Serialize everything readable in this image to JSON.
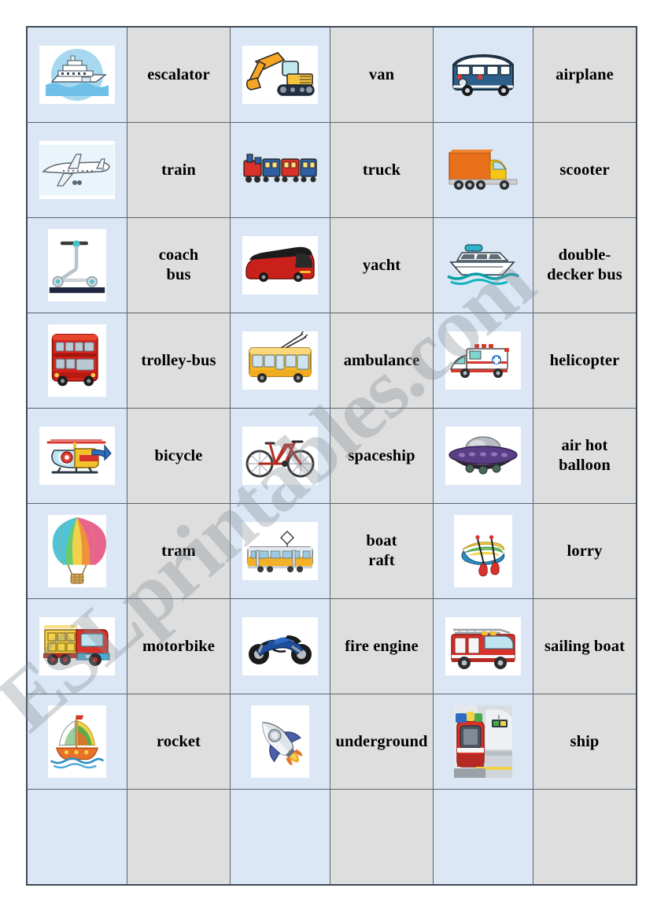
{
  "document": {
    "type": "domino-worksheet",
    "topic": "Transport",
    "columns": 6,
    "rows": 9,
    "colors": {
      "picture_cell_bg": "#dbe7f4",
      "word_cell_bg": "#dedede",
      "grid_line": "#5a646e",
      "table_border": "#3f4a55",
      "page_bg": "#ffffff",
      "watermark": "#828c96"
    }
  },
  "watermark": {
    "text": "ESLprintables.com"
  },
  "grid": {
    "rows": [
      {
        "cells": [
          {
            "kind": "picture",
            "icon": "cruise-ship-icon",
            "label": "cruise ship"
          },
          {
            "kind": "word",
            "lines": [
              "escalator"
            ]
          },
          {
            "kind": "picture",
            "icon": "excavator-icon",
            "label": "excavator"
          },
          {
            "kind": "word",
            "lines": [
              "van"
            ]
          },
          {
            "kind": "picture",
            "icon": "van-icon",
            "label": "blue van"
          },
          {
            "kind": "word",
            "lines": [
              "airplane"
            ]
          }
        ]
      },
      {
        "cells": [
          {
            "kind": "picture",
            "icon": "airplane-icon",
            "label": "airplane"
          },
          {
            "kind": "word",
            "lines": [
              "train"
            ]
          },
          {
            "kind": "picture",
            "icon": "train-icon",
            "label": "toy train"
          },
          {
            "kind": "word",
            "lines": [
              "truck"
            ]
          },
          {
            "kind": "picture",
            "icon": "truck-icon",
            "label": "orange truck"
          },
          {
            "kind": "word",
            "lines": [
              "scooter"
            ]
          }
        ]
      },
      {
        "cells": [
          {
            "kind": "picture",
            "icon": "kick-scooter-icon",
            "label": "kick scooter"
          },
          {
            "kind": "word",
            "lines": [
              "coach",
              "bus"
            ]
          },
          {
            "kind": "picture",
            "icon": "coach-bus-icon",
            "label": "red coach bus"
          },
          {
            "kind": "word",
            "lines": [
              "yacht"
            ]
          },
          {
            "kind": "picture",
            "icon": "yacht-icon",
            "label": "yacht"
          },
          {
            "kind": "word",
            "lines": [
              "double-",
              "decker bus"
            ]
          }
        ]
      },
      {
        "cells": [
          {
            "kind": "picture",
            "icon": "double-decker-bus-icon",
            "label": "double-decker bus"
          },
          {
            "kind": "word",
            "lines": [
              "trolley-bus"
            ]
          },
          {
            "kind": "picture",
            "icon": "trolley-bus-icon",
            "label": "trolley-bus"
          },
          {
            "kind": "word",
            "lines": [
              "ambulance"
            ]
          },
          {
            "kind": "picture",
            "icon": "ambulance-icon",
            "label": "ambulance"
          },
          {
            "kind": "word",
            "lines": [
              "helicopter"
            ]
          }
        ]
      },
      {
        "cells": [
          {
            "kind": "picture",
            "icon": "helicopter-icon",
            "label": "helicopter"
          },
          {
            "kind": "word",
            "lines": [
              "bicycle"
            ]
          },
          {
            "kind": "picture",
            "icon": "bicycle-icon",
            "label": "bicycle"
          },
          {
            "kind": "word",
            "lines": [
              "spaceship"
            ]
          },
          {
            "kind": "picture",
            "icon": "ufo-spaceship-icon",
            "label": "flying saucer"
          },
          {
            "kind": "word",
            "lines": [
              "air hot",
              "balloon"
            ]
          }
        ]
      },
      {
        "cells": [
          {
            "kind": "picture",
            "icon": "hot-air-balloon-icon",
            "label": "hot air balloon"
          },
          {
            "kind": "word",
            "lines": [
              "tram"
            ]
          },
          {
            "kind": "picture",
            "icon": "tram-icon",
            "label": "tram"
          },
          {
            "kind": "word",
            "lines": [
              "boat",
              "raft"
            ]
          },
          {
            "kind": "picture",
            "icon": "raft-icon",
            "label": "inflatable raft with paddles"
          },
          {
            "kind": "word",
            "lines": [
              "lorry"
            ]
          }
        ]
      },
      {
        "cells": [
          {
            "kind": "picture",
            "icon": "lorry-icon",
            "label": "dump lorry"
          },
          {
            "kind": "word",
            "lines": [
              "motorbike"
            ]
          },
          {
            "kind": "picture",
            "icon": "motorbike-icon",
            "label": "blue motorbike"
          },
          {
            "kind": "word",
            "lines": [
              "fire engine"
            ]
          },
          {
            "kind": "picture",
            "icon": "fire-engine-icon",
            "label": "fire engine"
          },
          {
            "kind": "word",
            "lines": [
              "sailing boat"
            ]
          }
        ]
      },
      {
        "cells": [
          {
            "kind": "picture",
            "icon": "sailing-boat-icon",
            "label": "sailing boat"
          },
          {
            "kind": "word",
            "lines": [
              "rocket"
            ]
          },
          {
            "kind": "picture",
            "icon": "rocket-icon",
            "label": "rocket"
          },
          {
            "kind": "word",
            "lines": [
              "underground"
            ]
          },
          {
            "kind": "picture",
            "icon": "underground-train-icon",
            "label": "underground train at platform"
          },
          {
            "kind": "word",
            "lines": [
              "ship"
            ]
          }
        ]
      },
      {
        "cells": [
          {
            "kind": "picture",
            "icon": "",
            "label": ""
          },
          {
            "kind": "word",
            "lines": []
          },
          {
            "kind": "picture",
            "icon": "",
            "label": ""
          },
          {
            "kind": "word",
            "lines": []
          },
          {
            "kind": "picture",
            "icon": "",
            "label": ""
          },
          {
            "kind": "word",
            "lines": []
          }
        ]
      }
    ]
  }
}
